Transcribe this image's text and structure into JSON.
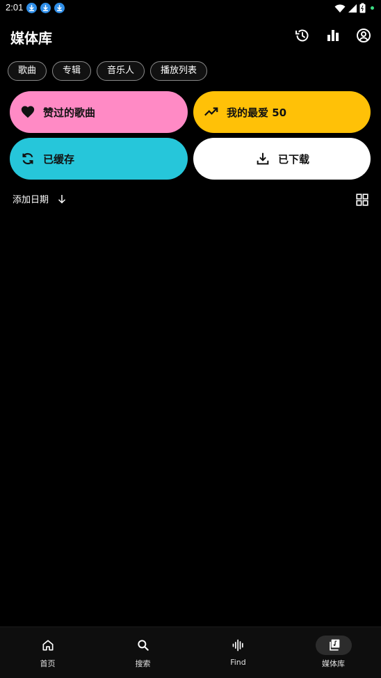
{
  "status_bar": {
    "time": "2:01"
  },
  "header": {
    "title": "媒体库"
  },
  "chips": [
    {
      "label": "歌曲"
    },
    {
      "label": "专辑"
    },
    {
      "label": "音乐人"
    },
    {
      "label": "播放列表"
    }
  ],
  "cards": {
    "liked": {
      "label": "赞过的歌曲",
      "color": "#ff8ac5"
    },
    "top50": {
      "label": "我的最爱 50",
      "color": "#ffc107"
    },
    "cached": {
      "label": "已缓存",
      "color": "#26c6da"
    },
    "downloaded": {
      "label": "已下载",
      "color": "#ffffff"
    }
  },
  "sort": {
    "label": "添加日期"
  },
  "bottom_nav": [
    {
      "label": "首页",
      "icon": "home-icon"
    },
    {
      "label": "搜索",
      "icon": "search-icon"
    },
    {
      "label": "Find",
      "icon": "waveform-icon"
    },
    {
      "label": "媒体库",
      "icon": "library-icon",
      "active": true
    }
  ]
}
